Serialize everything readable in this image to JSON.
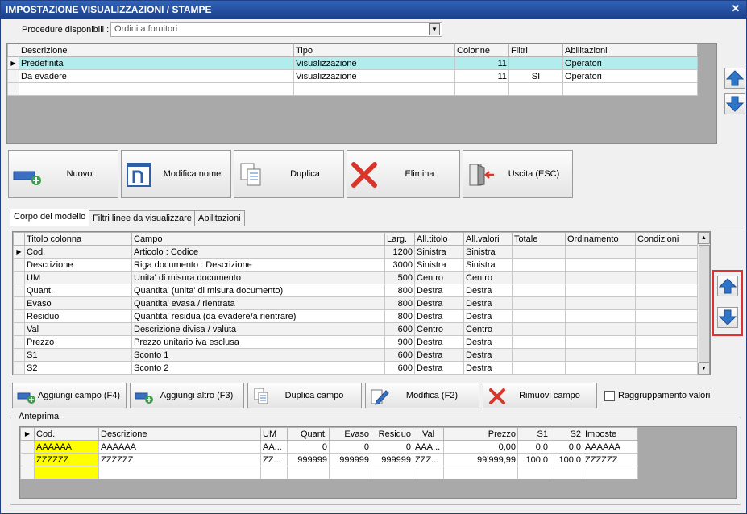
{
  "window": {
    "title": "IMPOSTAZIONE VISUALIZZAZIONI / STAMPE",
    "close": "✕"
  },
  "procedure": {
    "label": "Procedure disponibili :",
    "value": "Ordini a fornitori"
  },
  "top_grid": {
    "headers": [
      "Descrizione",
      "Tipo",
      "Colonne",
      "Filtri",
      "Abilitazioni"
    ],
    "rows": [
      [
        "Predefinita",
        "Visualizzazione",
        "11",
        "",
        "Operatori"
      ],
      [
        "Da evadere",
        "Visualizzazione",
        "11",
        "SI",
        "Operatori"
      ]
    ]
  },
  "buttons": {
    "nuovo": "Nuovo",
    "modifica_nome": "Modifica nome",
    "duplica": "Duplica",
    "elimina": "Elimina",
    "uscita": "Uscita (ESC)"
  },
  "tabs": [
    "Corpo del modello",
    "Filtri linee da visualizzare",
    "Abilitazioni"
  ],
  "body_grid": {
    "headers": [
      "Titolo colonna",
      "Campo",
      "Larg.",
      "All.titolo",
      "All.valori",
      "Totale",
      "Ordinamento",
      "Condizioni"
    ],
    "rows": [
      [
        "Cod.",
        "Articolo : Codice",
        "1200",
        "Sinistra",
        "Sinistra",
        "",
        "",
        ""
      ],
      [
        "Descrizione",
        "Riga documento : Descrizione",
        "3000",
        "Sinistra",
        "Sinistra",
        "",
        "",
        ""
      ],
      [
        "UM",
        "Unita' di misura documento",
        "500",
        "Centro",
        "Centro",
        "",
        "",
        ""
      ],
      [
        "Quant.",
        "Quantita' (unita' di misura documento)",
        "800",
        "Destra",
        "Destra",
        "",
        "",
        ""
      ],
      [
        "Evaso",
        "Quantita' evasa / rientrata",
        "800",
        "Destra",
        "Destra",
        "",
        "",
        ""
      ],
      [
        "Residuo",
        "Quantita' residua (da evadere/a rientrare)",
        "800",
        "Destra",
        "Destra",
        "",
        "",
        ""
      ],
      [
        "Val",
        "Descrizione divisa / valuta",
        "600",
        "Centro",
        "Centro",
        "",
        "",
        ""
      ],
      [
        "Prezzo",
        "Prezzo unitario iva esclusa",
        "900",
        "Destra",
        "Destra",
        "",
        "",
        ""
      ],
      [
        "S1",
        "Sconto 1",
        "600",
        "Destra",
        "Destra",
        "",
        "",
        ""
      ],
      [
        "S2",
        "Sconto 2",
        "600",
        "Destra",
        "Destra",
        "",
        "",
        ""
      ]
    ]
  },
  "field_buttons": {
    "aggiungi_campo": "Aggiungi campo (F4)",
    "aggiungi_altro": "Aggiungi altro (F3)",
    "duplica_campo": "Duplica campo",
    "modifica": "Modifica (F2)",
    "rimuovi_campo": "Rimuovi campo"
  },
  "raggruppamento": {
    "label": "Raggruppamento valori",
    "checked": false
  },
  "preview": {
    "legend": "Anteprima",
    "headers": [
      "Cod.",
      "Descrizione",
      "UM",
      "Quant.",
      "Evaso",
      "Residuo",
      "Val",
      "Prezzo",
      "S1",
      "S2",
      "Imposte"
    ],
    "rows": [
      [
        "AAAAAA",
        "AAAAAA",
        "AA...",
        "0",
        "0",
        "0",
        "AAA...",
        "0,00",
        "0.0",
        "0.0",
        "AAAAAA"
      ],
      [
        "ZZZZZZ",
        "ZZZZZZ",
        "ZZ...",
        "999999",
        "999999",
        "999999",
        "ZZZ...",
        "99'999,99",
        "100.0",
        "100.0",
        "ZZZZZZ"
      ]
    ]
  },
  "colors": {
    "title_bar": "#1c3f8a",
    "selected_row": "#b2eded",
    "highlight_cell": "#ffff00",
    "arrow_blue": "#2e75c7",
    "focus_border": "#e03030"
  }
}
